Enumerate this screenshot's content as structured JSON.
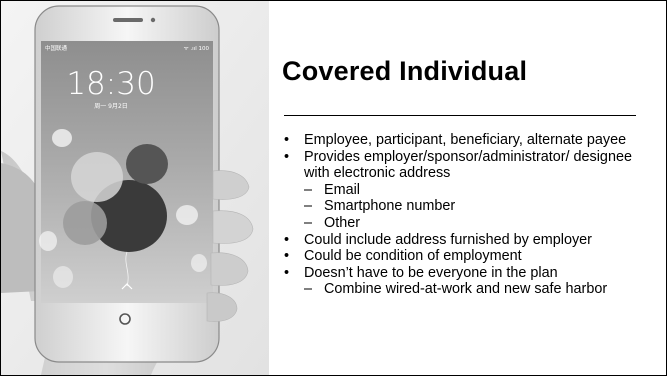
{
  "slide": {
    "title": "Covered Individual",
    "bullets": [
      {
        "level": 1,
        "text": "Employee, participant, beneficiary, alternate payee"
      },
      {
        "level": 1,
        "text": "Provides employer/sponsor/administrator/ designee with electronic address"
      },
      {
        "level": 2,
        "text": "Email"
      },
      {
        "level": 2,
        "text": "Smartphone number"
      },
      {
        "level": 2,
        "text": "Other"
      },
      {
        "level": 1,
        "text": "Could include address furnished by employer"
      },
      {
        "level": 1,
        "text": "Could be condition of employment"
      },
      {
        "level": 1,
        "text": "Doesn’t have to be everyone in the plan"
      },
      {
        "level": 2,
        "text": "Combine wired-at-work and new safe harbor"
      }
    ]
  },
  "phone": {
    "carrier": "中国联通",
    "status_right": "ᯤ .ııl 100",
    "clock": "18:30",
    "date": "周一 9月2日"
  }
}
